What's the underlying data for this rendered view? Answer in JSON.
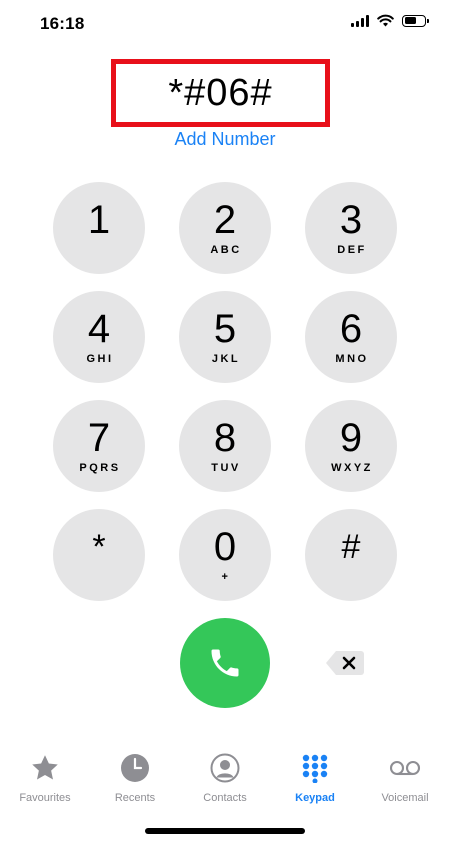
{
  "status_bar": {
    "time": "16:18",
    "battery_level": 0.6
  },
  "dialer": {
    "number": "*#06#",
    "add_number_label": "Add Number"
  },
  "keypad": [
    {
      "digit": "1",
      "letters": ""
    },
    {
      "digit": "2",
      "letters": "ABC"
    },
    {
      "digit": "3",
      "letters": "DEF"
    },
    {
      "digit": "4",
      "letters": "GHI"
    },
    {
      "digit": "5",
      "letters": "JKL"
    },
    {
      "digit": "6",
      "letters": "MNO"
    },
    {
      "digit": "7",
      "letters": "PQRS"
    },
    {
      "digit": "8",
      "letters": "TUV"
    },
    {
      "digit": "9",
      "letters": "WXYZ"
    },
    {
      "digit": "*",
      "letters": ""
    },
    {
      "digit": "0",
      "letters": "+"
    },
    {
      "digit": "#",
      "letters": ""
    }
  ],
  "tabs": [
    {
      "label": "Favourites",
      "icon": "star-icon"
    },
    {
      "label": "Recents",
      "icon": "clock-icon"
    },
    {
      "label": "Contacts",
      "icon": "person-icon"
    },
    {
      "label": "Keypad",
      "icon": "keypad-icon",
      "active": true
    },
    {
      "label": "Voicemail",
      "icon": "voicemail-icon"
    }
  ],
  "colors": {
    "accent": "#1a82f5",
    "call_green": "#34c759",
    "highlight_red": "#e8101a",
    "key_gray": "#e5e5e6",
    "tab_inactive": "#8e8e93"
  }
}
